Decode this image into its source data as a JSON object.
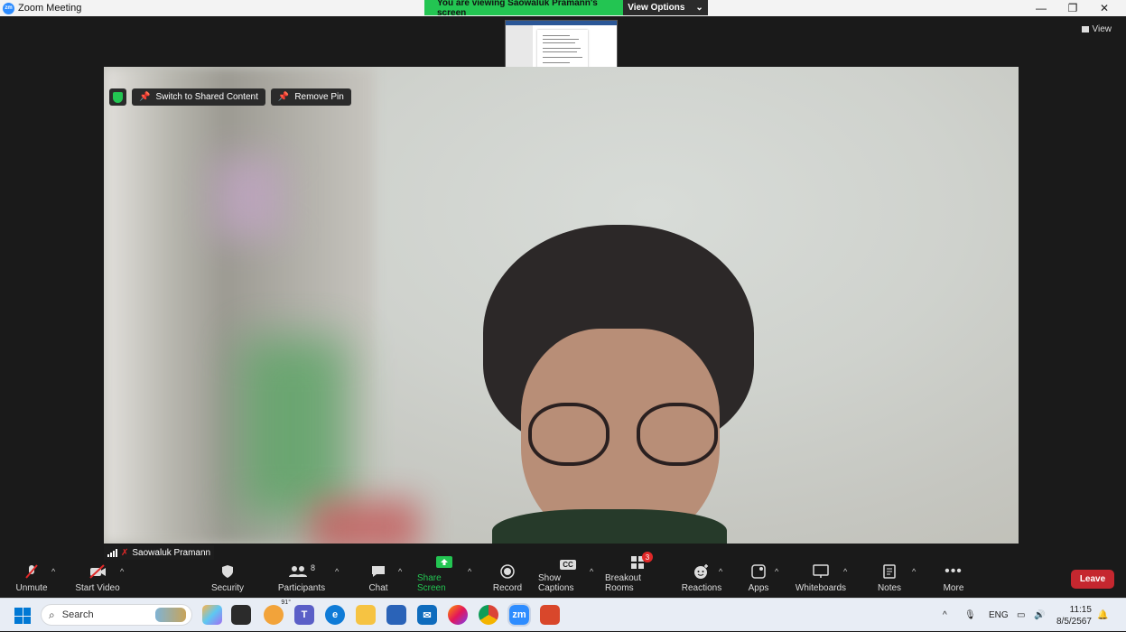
{
  "window": {
    "title": "Zoom Meeting",
    "logo_text": "zm",
    "minimize": "—",
    "restore": "❐",
    "close": "✕"
  },
  "banner": {
    "message": "You are viewing Saowaluk Pramann's screen",
    "options": "View Options",
    "options_caret": "⌄"
  },
  "view_button": "View",
  "pin_bar": {
    "switch_label": "Switch to Shared Content",
    "remove_label": "Remove Pin"
  },
  "participant_name": "Saowaluk Pramann",
  "toolbar": {
    "unmute": "Unmute",
    "start_video": "Start Video",
    "security": "Security",
    "participants": "Participants",
    "participants_count": "8",
    "chat": "Chat",
    "share_screen": "Share Screen",
    "record": "Record",
    "show_captions": "Show Captions",
    "captions_icon_text": "CC",
    "breakout_rooms": "Breakout Rooms",
    "breakout_badge": "3",
    "reactions": "Reactions",
    "apps": "Apps",
    "whiteboards": "Whiteboards",
    "notes": "Notes",
    "more": "More",
    "leave": "Leave"
  },
  "taskbar": {
    "search_placeholder": "Search",
    "weather_temp": "91°",
    "language": "ENG",
    "time": "11:15",
    "date": "8/5/2567"
  },
  "colors": {
    "banner_green": "#23c552",
    "leave_red": "#c5272f",
    "zoom_blue": "#2d8cff"
  }
}
